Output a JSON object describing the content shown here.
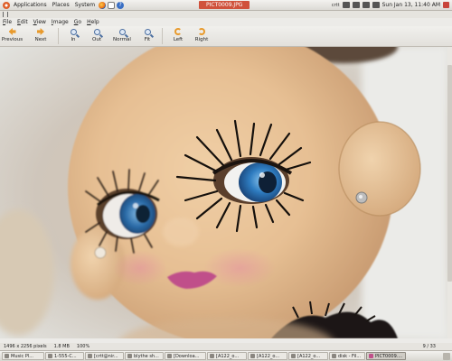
{
  "top_panel": {
    "menus": [
      "Applications",
      "Places",
      "System"
    ],
    "window_title": "PICT0009.JPG",
    "network_label": "crtt",
    "clock": "Sun Jan 13, 11:40 AM"
  },
  "menubar": {
    "items": [
      {
        "label": "File",
        "key": "F"
      },
      {
        "label": "Edit",
        "key": "E"
      },
      {
        "label": "View",
        "key": "V"
      },
      {
        "label": "Image",
        "key": "I"
      },
      {
        "label": "Go",
        "key": "G"
      },
      {
        "label": "Help",
        "key": "H"
      }
    ]
  },
  "toolbar": {
    "previous": "Previous",
    "next": "Next",
    "zoom_in": "In",
    "zoom_out": "Out",
    "normal": "Normal",
    "fit": "Fit",
    "rotate_left": "Left",
    "rotate_right": "Right"
  },
  "statusbar": {
    "dimensions": "1496 x 2256 pixels",
    "filesize": "1.8 MB",
    "zoom": "100%",
    "position": "9 / 33"
  },
  "taskbar": {
    "tasks": [
      "Music Pl...",
      "1-555-C...",
      "[crtt@nir...",
      "blythe sh...",
      "[Downloa...",
      "[A122_o...",
      "[A122_o...",
      "[A122_o...",
      "disk - Fil...",
      "PICT0009...."
    ]
  },
  "colors": {
    "title_accent": "#d0523c",
    "toolbar_arrow": "#e89a2c",
    "eye_blue": "#2e7cc0",
    "face_skin": "#e8c49a",
    "lips": "#c0508a"
  },
  "icons": {
    "previous": "go-previous-icon",
    "next": "go-next-icon",
    "zoom_in": "zoom-in-icon",
    "zoom_out": "zoom-out-icon",
    "normal": "zoom-original-icon",
    "fit": "zoom-fit-icon",
    "rotate_left": "rotate-left-icon",
    "rotate_right": "rotate-right-icon"
  }
}
